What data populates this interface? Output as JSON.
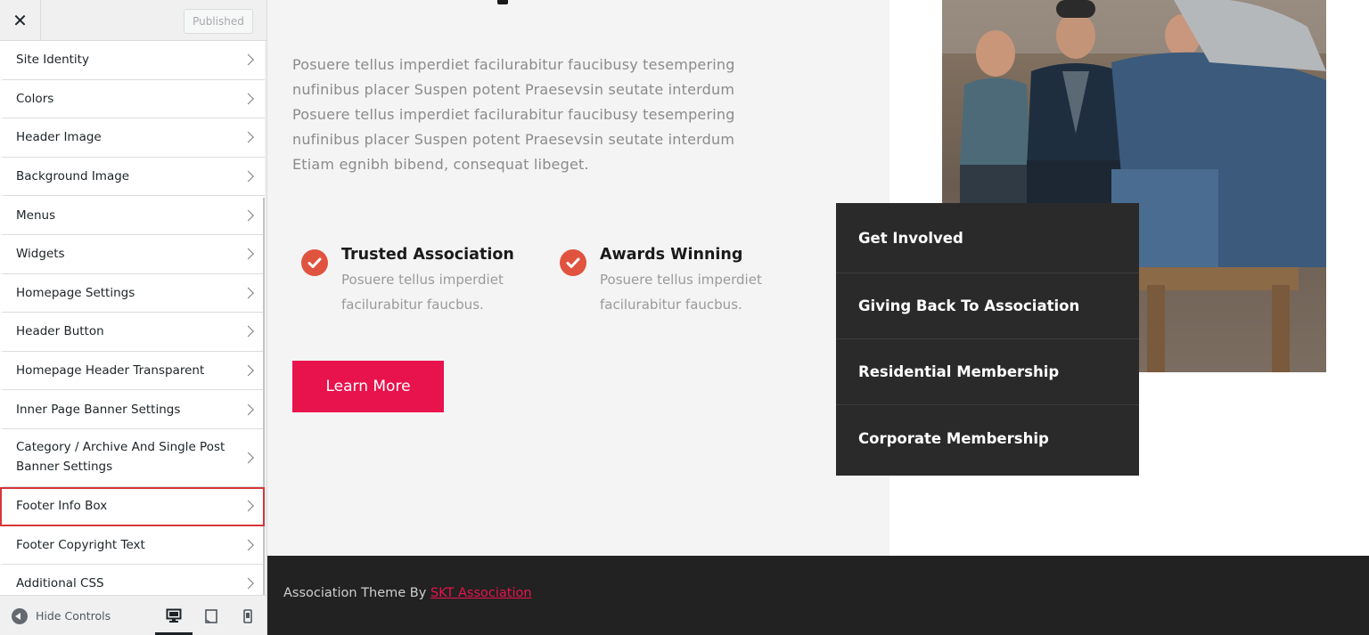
{
  "sidebar": {
    "close_label": "✕",
    "publish_label": "Published",
    "items": [
      {
        "label": "Site Identity"
      },
      {
        "label": "Colors"
      },
      {
        "label": "Header Image"
      },
      {
        "label": "Background Image"
      },
      {
        "label": "Menus"
      },
      {
        "label": "Widgets"
      },
      {
        "label": "Homepage Settings"
      },
      {
        "label": "Header Button"
      },
      {
        "label": "Homepage Header Transparent"
      },
      {
        "label": "Inner Page Banner Settings"
      },
      {
        "label": "Category / Archive And Single Post Banner Settings"
      },
      {
        "label": "Footer Info Box"
      },
      {
        "label": "Footer Copyright Text"
      },
      {
        "label": "Additional CSS"
      }
    ],
    "highlighted_item": "Footer Info Box",
    "footer": {
      "hide_controls_label": "Hide Controls",
      "devices": [
        {
          "icon": "desktop-icon",
          "active": true
        },
        {
          "icon": "tablet-icon",
          "active": false
        },
        {
          "icon": "mobile-icon",
          "active": false
        }
      ]
    }
  },
  "preview": {
    "intro_text": "Posuere tellus imperdiet facilurabitur faucibusy tesempering nufinibus placer Suspen potent Praesevsin seutate interdum Posuere tellus imperdiet facilurabitur faucibusy tesempering nufinibus placer Suspen potent Praesevsin seutate interdum Etiam egnibh bibend, consequat libeget.",
    "features": [
      {
        "title": "Trusted Association",
        "text": "Posuere tellus imperdiet facilurabitur faucbus."
      },
      {
        "title": "Awards Winning",
        "text": "Posuere tellus imperdiet facilurabitur faucbus."
      }
    ],
    "button_label": "Learn More",
    "dark_menu": [
      {
        "label": "Get Involved"
      },
      {
        "label": "Giving Back To Association"
      },
      {
        "label": "Residential Membership"
      },
      {
        "label": "Corporate Membership"
      }
    ],
    "footer": {
      "text": "Association Theme By ",
      "link": "SKT Association"
    }
  },
  "colors": {
    "accent": "#e8134c",
    "check": "#e0533e",
    "dark_box": "#2a2a2a",
    "footer_bg": "#222222",
    "highlight_outline": "#d63638"
  }
}
